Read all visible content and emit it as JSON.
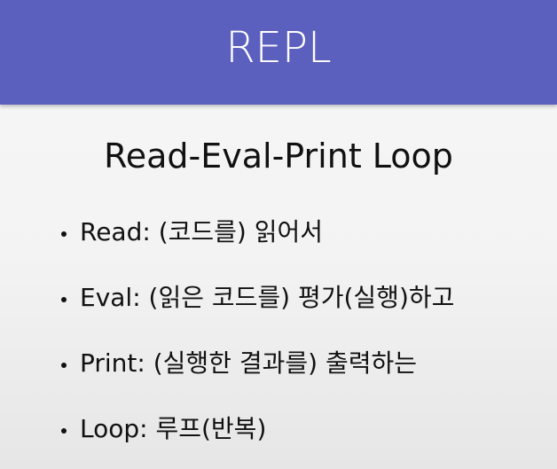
{
  "slide": {
    "title": "REPL",
    "subtitle": "Read-Eval-Print Loop",
    "bullets": [
      "Read: (코드를) 읽어서",
      "Eval: (읽은 코드를) 평가(실행)하고",
      "Print: (실행한 결과를) 출력하는",
      "Loop: 루프(반복)"
    ]
  },
  "colors": {
    "title_bar": "#5b5fbd",
    "title_text": "#ffffff",
    "body_text": "#111111",
    "background": "#f3f3f3"
  }
}
